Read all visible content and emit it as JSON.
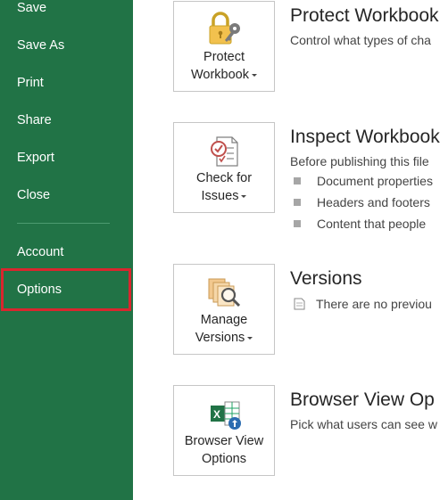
{
  "nav": {
    "items": [
      {
        "label": "Save"
      },
      {
        "label": "Save As"
      },
      {
        "label": "Print"
      },
      {
        "label": "Share"
      },
      {
        "label": "Export"
      },
      {
        "label": "Close"
      },
      {
        "label": "Account"
      },
      {
        "label": "Options"
      }
    ],
    "selected": "Options",
    "highlight_color": "#d9262e",
    "background_color": "#217346"
  },
  "sections": [
    {
      "button": {
        "line1": "Protect",
        "line2": "Workbook",
        "icon": "lock-key-icon",
        "has_dropdown": true
      },
      "title": "Protect Workbook",
      "description": "Control what types of cha"
    },
    {
      "button": {
        "line1": "Check for",
        "line2": "Issues",
        "icon": "checklist-icon",
        "has_dropdown": true
      },
      "title": "Inspect Workbook",
      "description": "Before publishing this file",
      "bullets": [
        "Document properties",
        "Headers and footers",
        "Content that people"
      ]
    },
    {
      "button": {
        "line1": "Manage",
        "line2": "Versions",
        "icon": "versions-icon",
        "has_dropdown": true
      },
      "title": "Versions",
      "note": "There are no previou"
    },
    {
      "button": {
        "line1": "Browser View",
        "line2": "Options",
        "icon": "excel-browser-icon",
        "has_dropdown": false
      },
      "title": "Browser View Op",
      "description": "Pick what users can see w"
    }
  ]
}
